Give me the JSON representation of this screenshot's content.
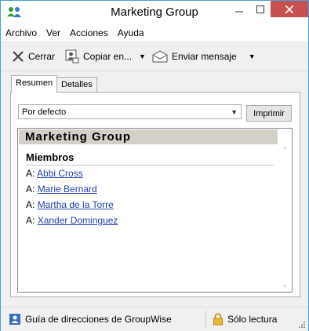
{
  "window": {
    "title": "Marketing Group"
  },
  "menu": {
    "items": [
      "Archivo",
      "Ver",
      "Acciones",
      "Ayuda"
    ]
  },
  "toolbar": {
    "close_label": "Cerrar",
    "copy_label": "Copiar en...",
    "send_label": "Enviar mensaje"
  },
  "tabs": {
    "summary": "Resumen",
    "details": "Detalles"
  },
  "view": {
    "selected": "Por defecto",
    "print_label": "Imprimir"
  },
  "group": {
    "name": "Marketing Group",
    "members_heading": "Miembros",
    "members": [
      {
        "prefix": "A:",
        "name": "Abbi Cross"
      },
      {
        "prefix": "A:",
        "name": "Marie Bernard"
      },
      {
        "prefix": "A:",
        "name": "Martha de la Torre"
      },
      {
        "prefix": "A:",
        "name": "Xander Dominguez"
      }
    ]
  },
  "status": {
    "left": "Guía de direcciones de GroupWise",
    "right": "Sólo lectura"
  },
  "colors": {
    "window_border": "#4a9fdc",
    "close_button": "#c75050",
    "header_band": "#d4d0c8",
    "link": "#1f3fa8"
  }
}
